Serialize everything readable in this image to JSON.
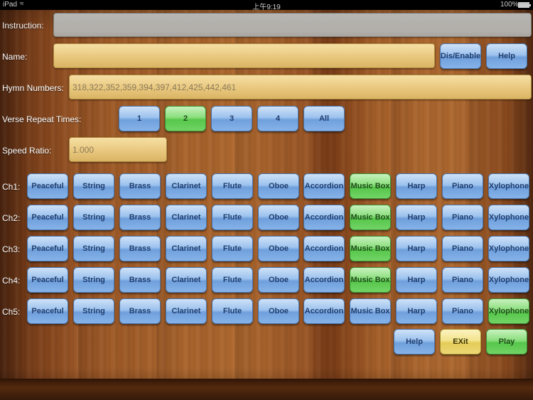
{
  "statusbar": {
    "device": "iPad",
    "wifi_icon": "wifi-icon",
    "time": "上午9:19",
    "battery": "100%"
  },
  "instruction": {
    "label": "Instruction:",
    "value": ""
  },
  "name": {
    "label": "Name:",
    "value": "",
    "toggle_label": "Dis/Enable",
    "help_label": "Help"
  },
  "hymn": {
    "label": "Hymn Numbers:",
    "placeholder": "318,322,352,359,394,397,412,425,442,461"
  },
  "verse": {
    "label": "Verse Repeat Times:",
    "options": [
      "1",
      "2",
      "3",
      "4",
      "All"
    ],
    "selected": "2"
  },
  "speed": {
    "label": "Speed Ratio:",
    "placeholder": "1.000"
  },
  "instruments": [
    "Peaceful",
    "String",
    "Brass",
    "Clarinet",
    "Flute",
    "Oboe",
    "Accordion",
    "Music Box",
    "Harp",
    "Piano",
    "Xylophone"
  ],
  "channels": [
    {
      "label": "Ch1:",
      "selected": "Music Box"
    },
    {
      "label": "Ch2:",
      "selected": "Music Box"
    },
    {
      "label": "Ch3:",
      "selected": "Music Box"
    },
    {
      "label": "Ch4:",
      "selected": "Music Box"
    },
    {
      "label": "Ch5:",
      "selected": "Xylophone"
    }
  ],
  "footer": {
    "help_label": "Help",
    "exit_label": "EXit",
    "play_label": "Play"
  },
  "colors": {
    "blue_button": "#86b3e8",
    "green_button": "#72d466",
    "yellow_button": "#ecd775",
    "tan_field": "#e9c87e",
    "gray_field": "#bdbab5"
  }
}
